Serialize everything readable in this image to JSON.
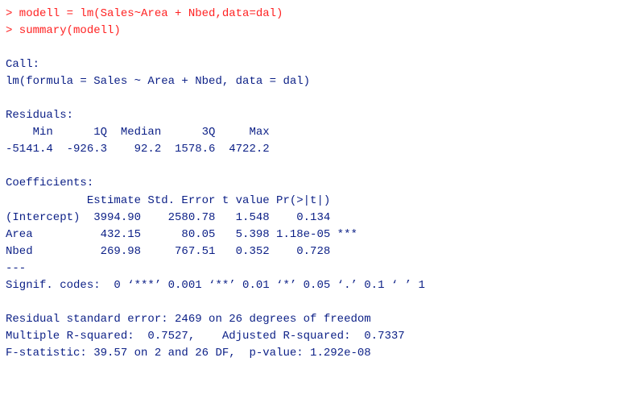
{
  "colors": {
    "input": "#ff2222",
    "output": "#0b1f86",
    "background": "#ffffff"
  },
  "lines": [
    {
      "type": "input",
      "text": "> modell = lm(Sales~Area + Nbed,data=dal)"
    },
    {
      "type": "input",
      "text": "> summary(modell)"
    },
    {
      "type": "blank",
      "text": ""
    },
    {
      "type": "output",
      "text": "Call:"
    },
    {
      "type": "output",
      "text": "lm(formula = Sales ~ Area + Nbed, data = dal)"
    },
    {
      "type": "blank",
      "text": ""
    },
    {
      "type": "output",
      "text": "Residuals:"
    },
    {
      "type": "output",
      "text": "    Min      1Q  Median      3Q     Max "
    },
    {
      "type": "output",
      "text": "-5141.4  -926.3    92.2  1578.6  4722.2 "
    },
    {
      "type": "blank",
      "text": ""
    },
    {
      "type": "output",
      "text": "Coefficients:"
    },
    {
      "type": "output",
      "text": "            Estimate Std. Error t value Pr(>|t|)    "
    },
    {
      "type": "output",
      "text": "(Intercept)  3994.90    2580.78   1.548    0.134    "
    },
    {
      "type": "output",
      "text": "Area          432.15      80.05   5.398 1.18e-05 ***"
    },
    {
      "type": "output",
      "text": "Nbed          269.98     767.51   0.352    0.728    "
    },
    {
      "type": "output",
      "text": "---"
    },
    {
      "type": "output",
      "text": "Signif. codes:  0 ‘***’ 0.001 ‘**’ 0.01 ‘*’ 0.05 ‘.’ 0.1 ‘ ’ 1"
    },
    {
      "type": "blank",
      "text": ""
    },
    {
      "type": "output",
      "text": "Residual standard error: 2469 on 26 degrees of freedom"
    },
    {
      "type": "output",
      "text": "Multiple R-squared:  0.7527,\tAdjusted R-squared:  0.7337 "
    },
    {
      "type": "output",
      "text": "F-statistic: 39.57 on 2 and 26 DF,  p-value: 1.292e-08"
    }
  ]
}
